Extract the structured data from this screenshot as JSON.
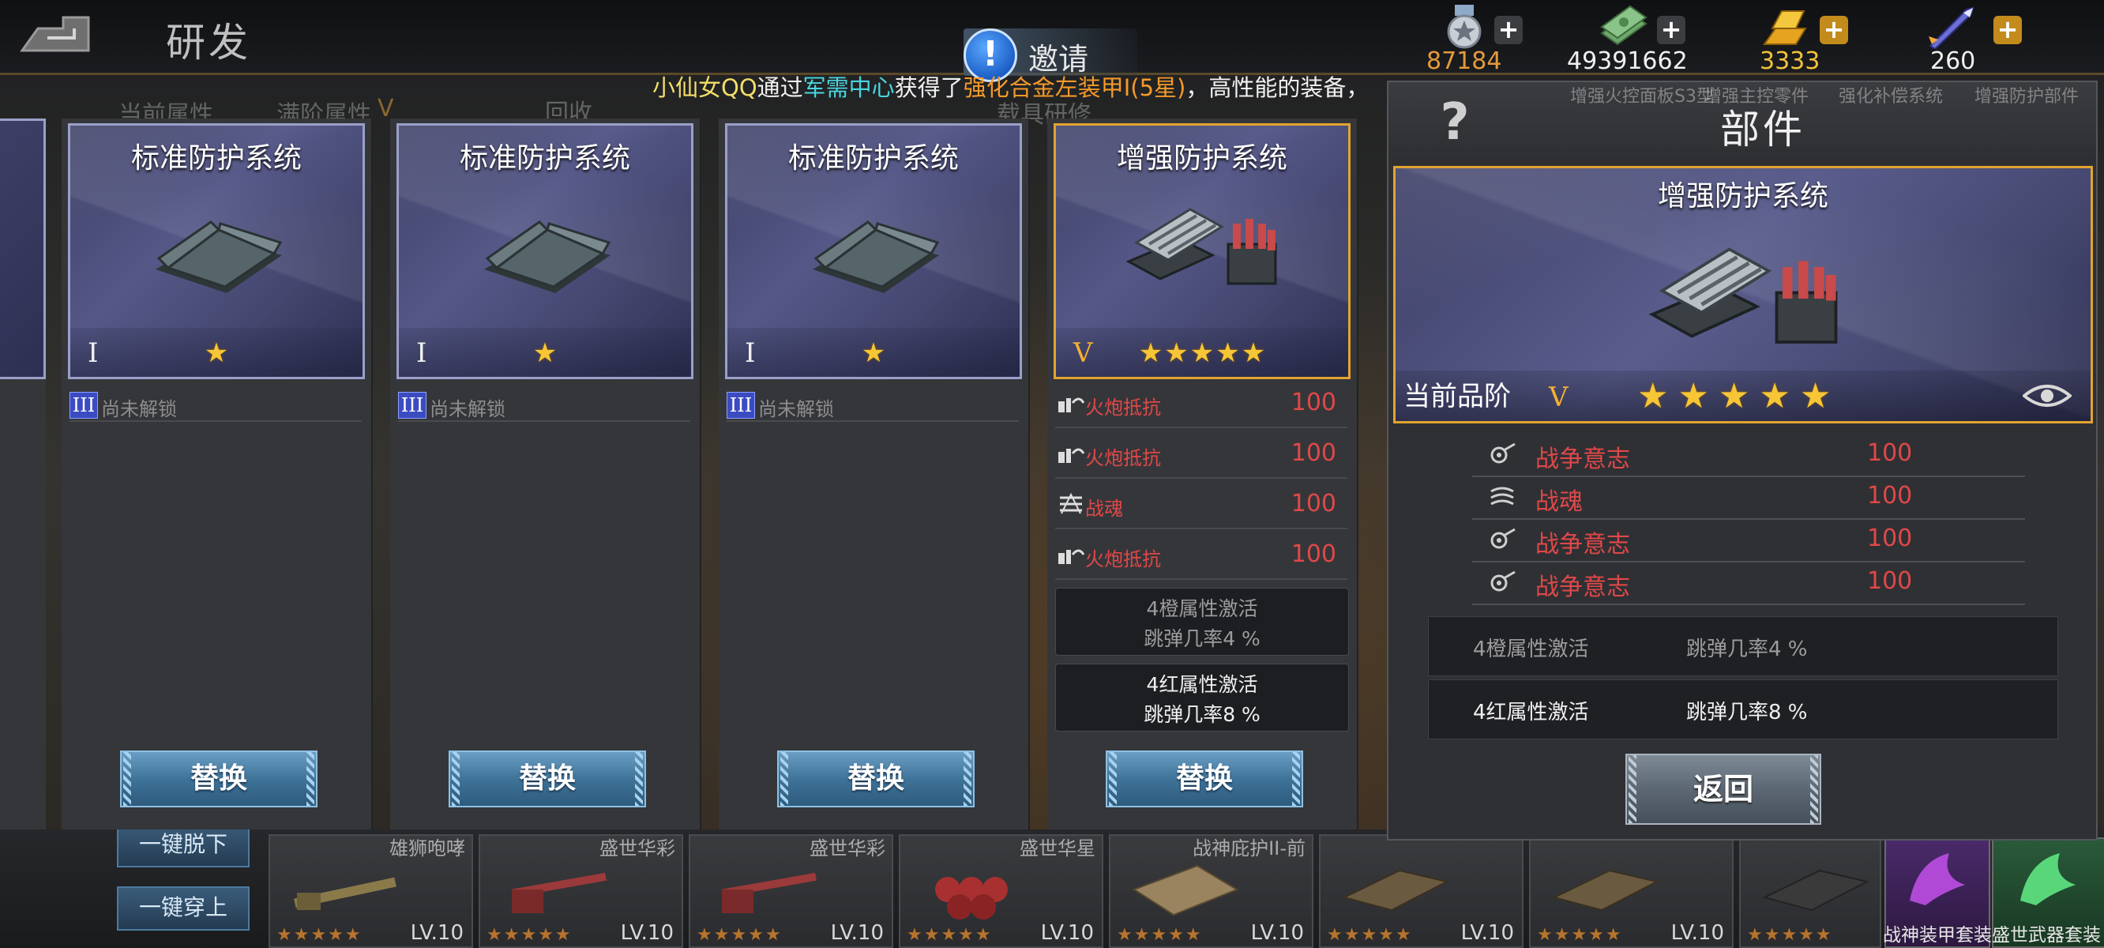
{
  "header": {
    "title": "研发",
    "invite_label": "邀请",
    "currencies": [
      {
        "icon": "medal-icon",
        "value": "87184",
        "color": "#e59a3a"
      },
      {
        "icon": "cash-stack-icon",
        "value": "49391662",
        "color": "#f0f0f0"
      },
      {
        "icon": "gold-bars-icon",
        "value": "3333",
        "color": "#f2c23a"
      },
      {
        "icon": "rocket-icon",
        "value": "260",
        "color": "#f0f0f0"
      }
    ]
  },
  "ticker": {
    "player": "小仙女QQ",
    "via": "通过",
    "source": "军需中心",
    "got": "获得了",
    "item": "强化合金左装甲I(5星)",
    "tail": "，高性能的装备，"
  },
  "background_text": {
    "current_attr": "当前属性",
    "full_attr": "满阶属性",
    "v_mark": "V",
    "recycle": "回收",
    "load_research": "载具研修",
    "unequip_all": "一键脱下",
    "equip_all": "一键穿上",
    "tank_names": [
      "雄狮咆哮",
      "盛世华彩",
      "盛世华彩",
      "盛世华星",
      "战神庇护II-前"
    ],
    "slot_level": "LV.10",
    "slot_stars": "★★★★★",
    "suit_armor": "战神装甲套装",
    "suit_weapon": "盛世武器套装",
    "detail_tabs": [
      "增强火控面板S3型",
      "增强主控零件",
      "强化补偿系统",
      "增强防护部件"
    ]
  },
  "cards": [
    {
      "title": "标准防护系统",
      "tier": "I",
      "stars": 1,
      "highlight": false,
      "locked_badge": "III",
      "locked_text": "尚未解锁",
      "button": "替换"
    },
    {
      "title": "标准防护系统",
      "tier": "I",
      "stars": 1,
      "highlight": false,
      "locked_badge": "III",
      "locked_text": "尚未解锁",
      "button": "替换"
    },
    {
      "title": "标准防护系统",
      "tier": "I",
      "stars": 1,
      "highlight": false,
      "locked_badge": "III",
      "locked_text": "尚未解锁",
      "button": "替换"
    },
    {
      "title": "增强防护系统",
      "tier": "V",
      "stars": 5,
      "highlight": true,
      "stats": [
        {
          "icon": "cannon-resist-icon",
          "name": "火炮抵抗",
          "value": "100"
        },
        {
          "icon": "cannon-resist-icon",
          "name": "火炮抵抗",
          "value": "100"
        },
        {
          "icon": "war-soul-icon",
          "name": "战魂",
          "value": "100"
        },
        {
          "icon": "cannon-resist-icon",
          "name": "火炮抵抗",
          "value": "100"
        }
      ],
      "attrs": [
        {
          "line1": "4橙属性激活",
          "line2": "跳弹几率4 %",
          "active": false
        },
        {
          "line1": "4红属性激活",
          "line2": "跳弹几率8 %",
          "active": true
        }
      ],
      "button": "替换"
    }
  ],
  "detail": {
    "panel_title": "部件",
    "help": "?",
    "item_title": "增强防护系统",
    "grade_label": "当前品阶",
    "grade_tier": "V",
    "stars": 5,
    "stats": [
      {
        "icon": "war-will-icon",
        "name": "战争意志",
        "value": "100"
      },
      {
        "icon": "war-soul-icon",
        "name": "战魂",
        "value": "100"
      },
      {
        "icon": "war-will-icon",
        "name": "战争意志",
        "value": "100"
      },
      {
        "icon": "war-will-icon",
        "name": "战争意志",
        "value": "100"
      }
    ],
    "attrs": [
      {
        "name": "4橙属性激活",
        "value": "跳弹几率4 %",
        "active": false
      },
      {
        "name": "4红属性激活",
        "value": "跳弹几率8 %",
        "active": true
      }
    ],
    "back_button": "返回"
  },
  "colors": {
    "stat_red": "#e04848",
    "gold_border": "#e2a430",
    "star": "#f6c636",
    "ticker_cyan": "#49d6e0",
    "ticker_orange": "#f59a2a"
  }
}
